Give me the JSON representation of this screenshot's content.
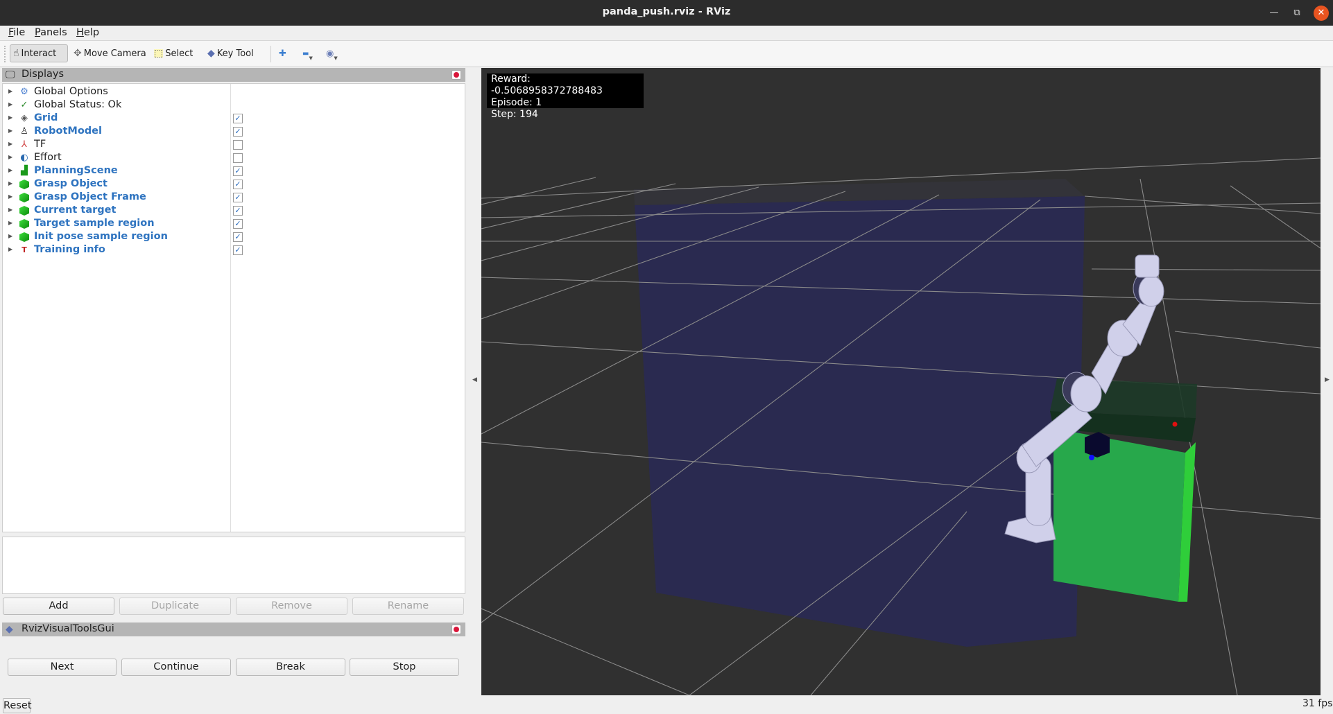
{
  "window": {
    "title": "panda_push.rviz - RViz",
    "controls": {
      "minimize": "—",
      "maximize": "⧉",
      "close": "✕"
    }
  },
  "menubar": {
    "items": [
      {
        "label": "File",
        "mnemonic": "F",
        "rest": "ile"
      },
      {
        "label": "Panels",
        "mnemonic": "P",
        "rest": "anels"
      },
      {
        "label": "Help",
        "mnemonic": "H",
        "rest": "elp"
      }
    ]
  },
  "toolbar": {
    "tools": [
      {
        "label": "Interact",
        "icon": "hand-pointer-icon",
        "glyph": "☝",
        "active": true
      },
      {
        "label": "Move Camera",
        "icon": "move-camera-icon",
        "glyph": "✥",
        "active": false
      },
      {
        "label": "Select",
        "icon": "select-box-icon",
        "glyph": "⬚",
        "active": false
      },
      {
        "label": "Key Tool",
        "icon": "key-diamond-icon",
        "glyph": "◆",
        "active": false
      }
    ],
    "extra": [
      {
        "icon": "add-tool-icon",
        "glyph": "✚"
      },
      {
        "icon": "remove-tool-icon",
        "glyph": "▬"
      },
      {
        "icon": "view-eye-icon",
        "glyph": "◉"
      }
    ]
  },
  "displays_panel": {
    "title": "Displays",
    "items": [
      {
        "label": "Global Options",
        "icon": "gear-icon",
        "glyph": "⚙",
        "enabled": false,
        "checkbox": null
      },
      {
        "label": "Global Status: Ok",
        "icon": "checkmark-icon",
        "glyph": "✓",
        "enabled": false,
        "checkbox": null
      },
      {
        "label": "Grid",
        "icon": "grid-icon",
        "glyph": "◈",
        "enabled": true,
        "checkbox": true
      },
      {
        "label": "RobotModel",
        "icon": "robot-model-icon",
        "glyph": "♙",
        "enabled": true,
        "checkbox": true
      },
      {
        "label": "TF",
        "icon": "tf-axes-icon",
        "glyph": "⅄",
        "enabled": false,
        "checkbox": false
      },
      {
        "label": "Effort",
        "icon": "effort-icon",
        "glyph": "◐",
        "enabled": false,
        "checkbox": false
      },
      {
        "label": "PlanningScene",
        "icon": "planning-scene-icon",
        "glyph": "▟",
        "enabled": true,
        "checkbox": true
      },
      {
        "label": "Grasp Object",
        "icon": "marker-cube-icon",
        "glyph": "cube",
        "enabled": true,
        "checkbox": true
      },
      {
        "label": "Grasp Object Frame",
        "icon": "marker-cube-icon",
        "glyph": "cube",
        "enabled": true,
        "checkbox": true
      },
      {
        "label": "Current target",
        "icon": "marker-cube-icon",
        "glyph": "cube",
        "enabled": true,
        "checkbox": true
      },
      {
        "label": "Target sample region",
        "icon": "marker-cube-icon",
        "glyph": "cube",
        "enabled": true,
        "checkbox": true
      },
      {
        "label": "Init pose sample region",
        "icon": "marker-cube-icon",
        "glyph": "cube",
        "enabled": true,
        "checkbox": true
      },
      {
        "label": "Training info",
        "icon": "overlay-text-icon",
        "glyph": "T",
        "enabled": true,
        "checkbox": true
      }
    ],
    "buttons": {
      "add": "Add",
      "duplicate": "Duplicate",
      "remove": "Remove",
      "rename": "Rename"
    }
  },
  "visual_tools_panel": {
    "title": "RvizVisualToolsGui",
    "buttons": {
      "next": "Next",
      "continue": "Continue",
      "break": "Break",
      "stop": "Stop"
    }
  },
  "reset_label": "Reset",
  "viewport": {
    "hud": {
      "reward": "Reward: -0.5068958372788483",
      "episode": "Episode: 1",
      "step": "Step: 194"
    },
    "colors": {
      "background": "#303030",
      "grid": "#a0a0a0",
      "region_blue": "#2a2a50",
      "region_green": "#27a84b",
      "robot": "#d0d0ea",
      "target_marker": "#e01010",
      "object_marker": "#1010ff"
    }
  },
  "status": {
    "fps": "31 fps"
  }
}
